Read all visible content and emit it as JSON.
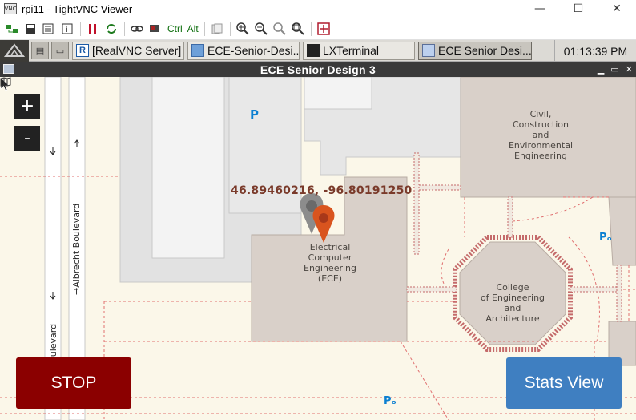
{
  "vnc": {
    "title": "rpi11 - TightVNC Viewer",
    "app_icon": "VNC",
    "ctrl_label": "Ctrl",
    "alt_label": "Alt"
  },
  "taskbar": {
    "tasks": [
      {
        "label": "[RealVNC Server]",
        "icon": "realvnc-icon"
      },
      {
        "label": "ECE-Senior-Desi...",
        "icon": "folder-icon"
      },
      {
        "label": "LXTerminal",
        "icon": "terminal-icon"
      },
      {
        "label": "ECE Senior Desi...",
        "icon": "window-icon"
      }
    ],
    "clock": "01:13:39 PM"
  },
  "app": {
    "title": "ECE Senior Design 3"
  },
  "map": {
    "coordinates": "46.89460216, -96.80191250",
    "zoom_in": "+",
    "zoom_out": "-",
    "buildings": [
      {
        "lines": [
          "Civil,",
          "Construction",
          "and",
          "Environmental",
          "Engineering"
        ]
      },
      {
        "lines": [
          "Electrical",
          "Computer",
          "Engineering",
          "(ECE)"
        ]
      },
      {
        "lines": [
          "College",
          "of Engineering",
          "and",
          "Architecture"
        ]
      }
    ],
    "road_labels": [
      "→Albrecht Boulevard",
      "oulevard"
    ],
    "parking": "P"
  },
  "controls": {
    "stop": "STOP",
    "stats": "Stats View"
  },
  "colors": {
    "stop": "#8b0000",
    "stats": "#3f7fc1",
    "marker_gray": "#8c8c8c",
    "marker_orange": "#d9541e"
  }
}
